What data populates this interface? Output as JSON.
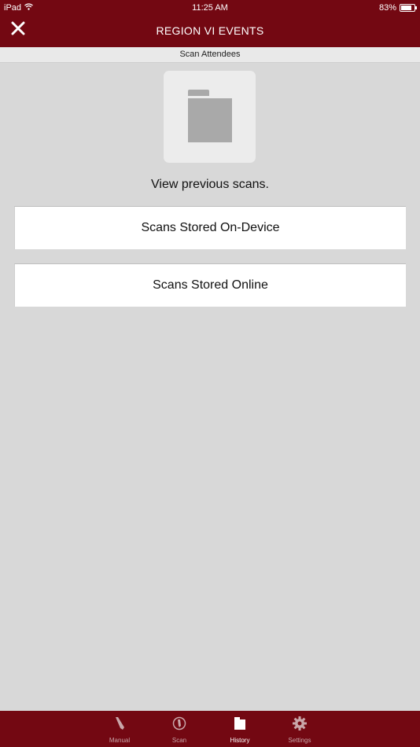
{
  "status_bar": {
    "device": "iPad",
    "time": "11:25 AM",
    "battery_percent_label": "83%",
    "battery_level": 0.83
  },
  "header": {
    "title": "REGION VI EVENTS",
    "close_icon": "close-icon"
  },
  "sub_header": {
    "label": "Scan Attendees"
  },
  "main": {
    "folder_icon": "folder-icon",
    "prompt": "View previous scans.",
    "buttons": [
      {
        "label": "Scans Stored On-Device"
      },
      {
        "label": "Scans Stored Online"
      }
    ]
  },
  "tab_bar": {
    "items": [
      {
        "label": "Manual",
        "icon": "pencil-icon",
        "active": false
      },
      {
        "label": "Scan",
        "icon": "scan-icon",
        "active": false
      },
      {
        "label": "History",
        "icon": "history-folder-icon",
        "active": true
      },
      {
        "label": "Settings",
        "icon": "gear-icon",
        "active": false
      }
    ]
  },
  "colors": {
    "brand": "#730812",
    "background": "#d8d8d8",
    "tab_inactive": "#c9a6a9",
    "tab_active": "#ffffff"
  }
}
